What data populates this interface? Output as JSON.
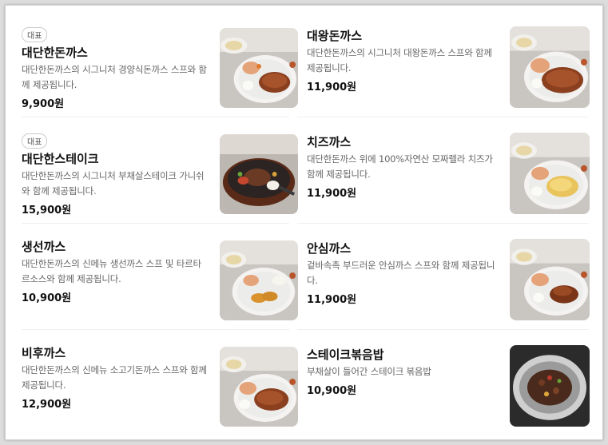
{
  "items": [
    {
      "badge": "대표",
      "name": "대단한돈까스",
      "desc": "대단한돈까스의 시그니처 경양식돈까스 스프와 함께 제공됩니다.",
      "price": "9,900원",
      "image": "donkatsu-plate-photo"
    },
    {
      "badge": "",
      "name": "대왕돈까스",
      "desc": "대단한돈까스의 시그니처 대왕돈까스 스프와 함께 제공됩니다.",
      "price": "11,900원",
      "image": "large-donkatsu-plate-photo"
    },
    {
      "badge": "대표",
      "name": "대단한스테이크",
      "desc": "대단한돈까스의 시그니처 부채살스테이크 가니쉬와 함께 제공됩니다.",
      "price": "15,900원",
      "image": "steak-skillet-photo"
    },
    {
      "badge": "",
      "name": "치즈까스",
      "desc": "대단한돈까스 위에 100%자연산 모짜렐라 치즈가 함께 제공됩니다.",
      "price": "11,900원",
      "image": "cheese-katsu-plate-photo"
    },
    {
      "badge": "",
      "name": "생선까스",
      "desc": "대단한돈까스의 신메뉴 생선까스 스프 및 타르타르소스와 함께 제공됩니다.",
      "price": "10,900원",
      "image": "fish-katsu-plate-photo"
    },
    {
      "badge": "",
      "name": "안심까스",
      "desc": "겉바속촉 부드러운 안심까스 스프와 함께 제공됩니다.",
      "price": "11,900원",
      "image": "tenderloin-katsu-plate-photo"
    },
    {
      "badge": "",
      "name": "비후까스",
      "desc": "대단한돈까스의 신메뉴 소고기돈까스 스프와 함께 제공됩니다.",
      "price": "12,900원",
      "image": "beef-katsu-plate-photo"
    },
    {
      "badge": "",
      "name": "스테이크볶음밥",
      "desc": "부채살이 들어간 스테이크 볶음밥",
      "price": "10,900원",
      "image": "steak-fried-rice-photo"
    }
  ]
}
